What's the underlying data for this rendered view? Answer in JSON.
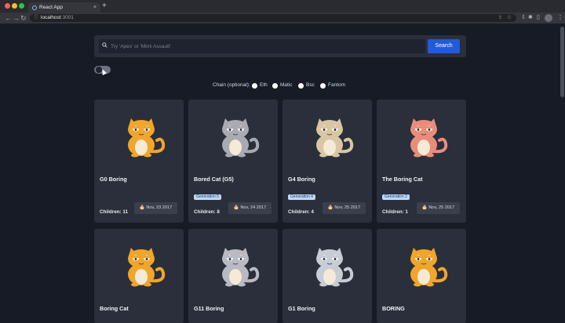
{
  "browser": {
    "tab_title": "React App",
    "tab_close": "×",
    "new_tab": "+",
    "url_host": "localhost",
    "url_port": ":3001"
  },
  "search": {
    "placeholder": "Try 'Apes' or 'Mimi Assault'",
    "value": "",
    "button_label": "Search"
  },
  "chain": {
    "label": "Chain (optional):",
    "options": [
      "Eth",
      "Matic",
      "Bsc",
      "Fantom"
    ]
  },
  "cards": [
    {
      "name": "G0 Boring",
      "generation": "",
      "children": "Children: 11",
      "date": "Nov, 23 2017",
      "color": "#f0a52b"
    },
    {
      "name": "Bored Cat (G5)",
      "generation": "Generation 5",
      "children": "Children: 8",
      "date": "Nov, 24 2017",
      "color": "#a9aab3"
    },
    {
      "name": "G4 Boring",
      "generation": "Generation 4",
      "children": "Children: 4",
      "date": "Nov, 25 2017",
      "color": "#d9c7a3"
    },
    {
      "name": "The Boring Cat",
      "generation": "Generation 2",
      "children": "Children: 1",
      "date": "Nov, 25 2017",
      "color": "#e98d7b"
    },
    {
      "name": "Boring Cat",
      "generation": "",
      "children": "",
      "date": "",
      "color": "#f0a52b"
    },
    {
      "name": "G11 Boring",
      "generation": "",
      "children": "",
      "date": "",
      "color": "#b9bac4"
    },
    {
      "name": "G1 Boring",
      "generation": "",
      "children": "",
      "date": "",
      "color": "#c7ccd6"
    },
    {
      "name": "BORING",
      "generation": "",
      "children": "",
      "date": "",
      "color": "#f0a52b"
    }
  ],
  "colors": {
    "accent": "#2459d8",
    "badge_bg": "#bcd7f7",
    "card_bg": "#2a2f3b",
    "page_bg": "#161b26"
  }
}
